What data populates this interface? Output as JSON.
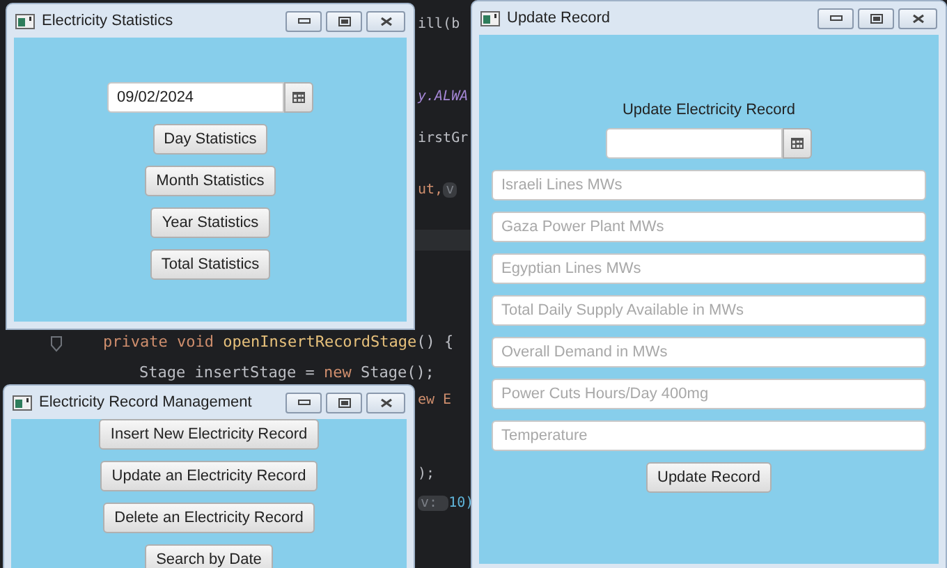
{
  "editor": {
    "lines": [
      {
        "segments": [
          {
            "text": "ill(b",
            "kind": "plain"
          }
        ]
      },
      {
        "segments": [
          {
            "text": "y.ALWA",
            "kind": "field"
          }
        ]
      },
      {
        "segments": [
          {
            "text": "irstGr",
            "kind": "plain"
          }
        ]
      },
      {
        "segments": [
          {
            "text": "ut,",
            "kind": "keyword"
          },
          {
            "text": "v",
            "kind": "hint"
          }
        ]
      },
      {
        "segments": [
          {
            "text": "private void ",
            "kind": "keyword"
          },
          {
            "text": "openInsertRecordStage",
            "kind": "method"
          },
          {
            "text": "() {",
            "kind": "plain"
          }
        ]
      },
      {
        "segments": [
          {
            "text": "Stage insertStage = ",
            "kind": "plain"
          },
          {
            "text": "new ",
            "kind": "keyword"
          },
          {
            "text": "Stage();",
            "kind": "plain"
          }
        ]
      },
      {
        "segments": [
          {
            "text": "ew E",
            "kind": "keyword"
          }
        ]
      },
      {
        "segments": [
          {
            "text": ");",
            "kind": "plain"
          }
        ]
      },
      {
        "segments": [
          {
            "text": "v: ",
            "kind": "hint"
          },
          {
            "text": "10)",
            "kind": "number"
          }
        ]
      }
    ]
  },
  "statistics_window": {
    "title": "Electricity Statistics",
    "date_picker": {
      "value": "09/02/2024"
    },
    "buttons": [
      "Day Statistics",
      "Month Statistics",
      "Year Statistics",
      "Total Statistics"
    ]
  },
  "management_window": {
    "title": "Electricity Record Management",
    "buttons": [
      "Insert New Electricity Record",
      "Update an Electricity Record",
      "Delete an Electricity Record",
      "Search by Date"
    ]
  },
  "update_window": {
    "title": "Update Record",
    "heading": "Update Electricity Record",
    "fields": [
      {
        "placeholder": "Israeli Lines MWs"
      },
      {
        "placeholder": "Gaza Power Plant MWs"
      },
      {
        "placeholder": "Egyptian Lines MWs"
      },
      {
        "placeholder": "Total Daily Supply Available in MWs"
      },
      {
        "placeholder": "Overall Demand in MWs"
      },
      {
        "placeholder": "Power Cuts Hours/Day 400mg"
      },
      {
        "placeholder": "Temperature"
      }
    ],
    "button": "Update Record"
  }
}
